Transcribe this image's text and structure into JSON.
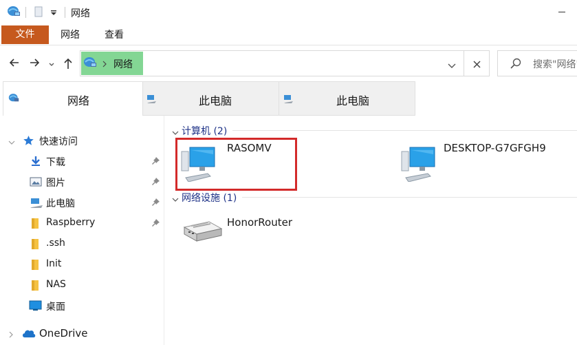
{
  "window": {
    "title": "网络"
  },
  "ribbon": {
    "file_tab": "文件",
    "tabs": [
      "网络",
      "查看"
    ]
  },
  "address": {
    "current": "网络"
  },
  "search": {
    "placeholder": "搜索\"网络\""
  },
  "folder_tabs": [
    {
      "label": "网络",
      "active": true
    },
    {
      "label": "此电脑",
      "active": false
    },
    {
      "label": "此电脑",
      "active": false
    }
  ],
  "sidebar": {
    "quick_access": "快速访问",
    "items": [
      {
        "label": "下载",
        "icon": "download-icon",
        "pinned": true
      },
      {
        "label": "图片",
        "icon": "pictures-icon",
        "pinned": true
      },
      {
        "label": "此电脑",
        "icon": "this-pc-icon",
        "pinned": true
      },
      {
        "label": "Raspberry",
        "icon": "folder-icon",
        "pinned": true
      },
      {
        "label": ".ssh",
        "icon": "folder-icon",
        "pinned": false
      },
      {
        "label": "Init",
        "icon": "folder-icon",
        "pinned": false
      },
      {
        "label": "NAS",
        "icon": "folder-icon",
        "pinned": false
      },
      {
        "label": "桌面",
        "icon": "desktop-icon",
        "pinned": false
      }
    ],
    "onedrive": "OneDrive"
  },
  "groups": {
    "computers": {
      "header": "计算机 (2)",
      "items": [
        {
          "name": "RASOMV",
          "icon": "computer-icon"
        },
        {
          "name": "DESKTOP-G7GFGH9",
          "icon": "computer-icon"
        }
      ]
    },
    "network_devices": {
      "header": "网络设施 (1)",
      "items": [
        {
          "name": "HonorRouter",
          "icon": "router-icon"
        }
      ]
    }
  },
  "colors": {
    "file_tab": "#c6591e",
    "address_highlight": "#83d694",
    "group_header": "#1e3287",
    "selection_outline": "#d32a2a"
  }
}
